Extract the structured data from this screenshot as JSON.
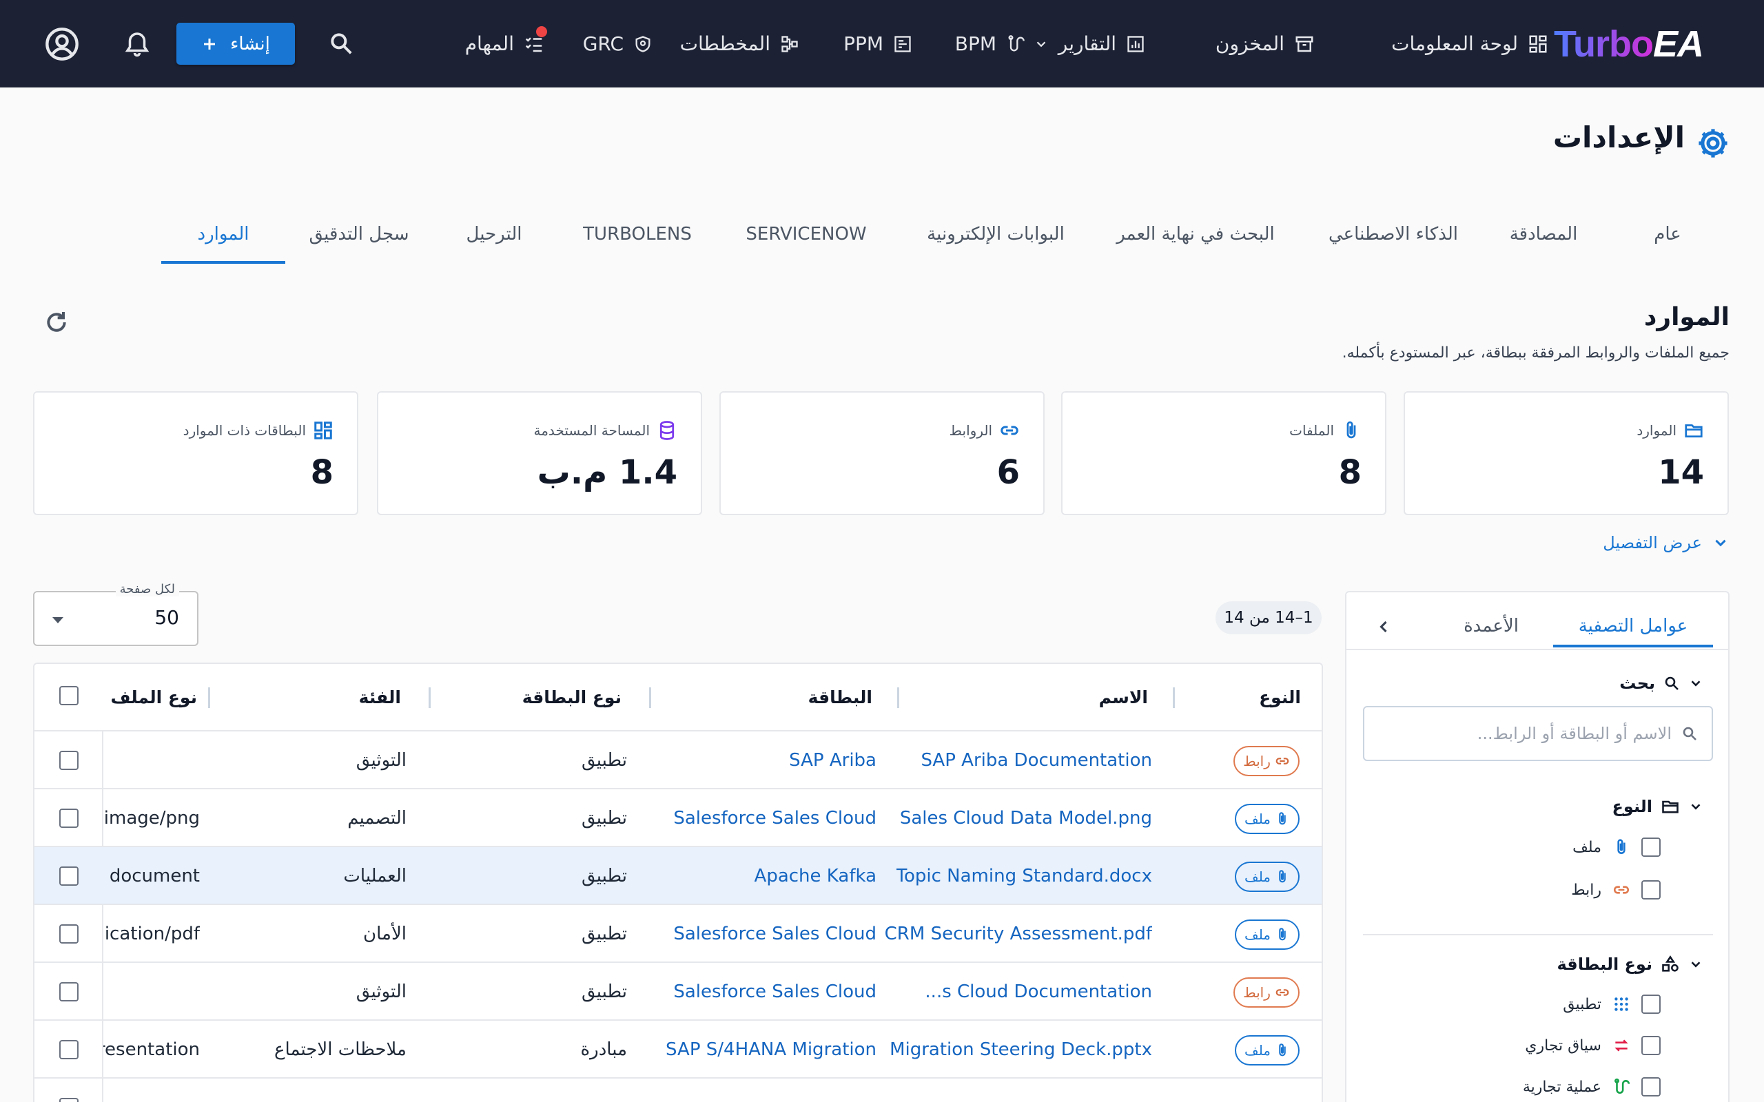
{
  "app": {
    "logo_text_1": "Turbo",
    "logo_text_2": "EA"
  },
  "nav": {
    "dashboard": "لوحة المعلومات",
    "inventory": "المخزون",
    "reports": "التقارير",
    "bpm": "BPM",
    "ppm": "PPM",
    "diagrams": "المخططات",
    "grc": "GRC",
    "tasks": "المهام",
    "create_button": "إنشاء"
  },
  "page_title": "الإعدادات",
  "tabs": [
    "عام",
    "المصادقة",
    "الذكاء الاصطناعي",
    "البحث في نهاية العمر",
    "البوابات الإلكترونية",
    "SERVICENOW",
    "TURBOLENS",
    "الترحيل",
    "سجل التدقيق",
    "الموارد"
  ],
  "section": {
    "title": "الموارد",
    "description": "جميع الملفات والروابط المرفقة ببطاقة، عبر المستودع بأكمله."
  },
  "stats": [
    {
      "label": "الموارد",
      "value": "14",
      "icon": "folder-icon",
      "color": "#1976d2"
    },
    {
      "label": "الملفات",
      "value": "8",
      "icon": "paperclip-icon",
      "color": "#1976d2"
    },
    {
      "label": "الروابط",
      "value": "6",
      "icon": "link-icon",
      "color": "#1976d2"
    },
    {
      "label": "المساحة المستخدمة",
      "value": "1.4 م.ب",
      "icon": "database-icon",
      "color": "#7c3aed"
    },
    {
      "label": "البطاقات ذات الموارد",
      "value": "8",
      "icon": "dashboard-icon",
      "color": "#1976d2"
    }
  ],
  "details_toggle": "عرض التفصيل",
  "filter_panel": {
    "tab_filters": "عوامل التصفية",
    "tab_columns": "الأعمدة",
    "search_title": "بحث",
    "search_placeholder": "الاسم أو البطاقة أو الرابط...",
    "type_title": "النوع",
    "type_options": [
      "ملف",
      "رابط"
    ],
    "card_type_title": "نوع البطاقة",
    "card_type_options": [
      "تطبيق",
      "سياق تجاري",
      "عملية تجارية"
    ]
  },
  "table": {
    "count": "1–14 من 14",
    "per_page_label": "لكل صفحة",
    "per_page_value": "50",
    "headers": [
      "النوع",
      "الاسم",
      "البطاقة",
      "نوع البطاقة",
      "الفئة",
      "نوع الملف"
    ],
    "rows": [
      {
        "type": "رابط",
        "kind": "link",
        "name": "SAP Ariba Documentation",
        "card": "SAP Ariba",
        "card_type": "تطبيق",
        "category": "التوثيق",
        "file_type": ""
      },
      {
        "type": "ملف",
        "kind": "file",
        "name": "Sales Cloud Data Model.png",
        "card": "Salesforce Sales Cloud",
        "card_type": "تطبيق",
        "category": "التصميم",
        "file_type": "image/png"
      },
      {
        "type": "ملف",
        "kind": "file",
        "name": "Topic Naming Standard.docx",
        "card": "Apache Kafka",
        "card_type": "تطبيق",
        "category": "العمليات",
        "file_type": "document"
      },
      {
        "type": "ملف",
        "kind": "file",
        "name": "CRM Security Assessment.pdf",
        "card": "Salesforce Sales Cloud",
        "card_type": "تطبيق",
        "category": "الأمان",
        "file_type": "application/pdf"
      },
      {
        "type": "رابط",
        "kind": "link",
        "name": "...s Cloud Documentation",
        "card": "Salesforce Sales Cloud",
        "card_type": "تطبيق",
        "category": "التوثيق",
        "file_type": ""
      },
      {
        "type": "ملف",
        "kind": "file",
        "name": "Migration Steering Deck.pptx",
        "card": "SAP S/4HANA Migration",
        "card_type": "مبادرة",
        "category": "ملاحظات الاجتماع",
        "file_type": "presentation"
      }
    ]
  }
}
